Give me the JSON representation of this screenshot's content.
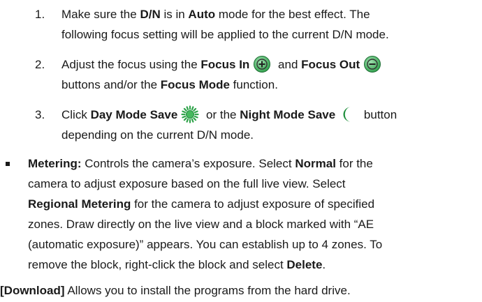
{
  "steps": [
    {
      "num": "1.",
      "l1_a": "Make sure the ",
      "l1_b": "D/N",
      "l1_c": " is in ",
      "l1_d": "Auto",
      "l1_e": " mode for the best effect. The",
      "l2": "following focus setting will be applied to the current D/N mode."
    },
    {
      "num": "2.",
      "l1_a": "Adjust the focus using the ",
      "l1_b": "Focus In",
      "l1_c": " and ",
      "l1_d": "Focus Out",
      "l2_a": "buttons and/or the ",
      "l2_b": "Focus Mode",
      "l2_c": " function."
    },
    {
      "num": "3.",
      "l1_a": "Click ",
      "l1_b": "Day Mode Save",
      "l1_c": " or the ",
      "l1_d": "Night Mode Save",
      "l1_e": " button",
      "l2": "depending on the current D/N mode."
    }
  ],
  "metering": {
    "l1_a": "Metering:",
    "l1_b": " Controls the camera’s exposure. Select ",
    "l1_c": "Normal",
    "l1_d": " for the",
    "l2": "camera to adjust exposure based on the full live view. Select",
    "l3_a": "Regional Metering",
    "l3_b": " for the camera to adjust exposure of specified",
    "l4": "zones. Draw directly on the live view and a block marked with “AE",
    "l5": "(automatic exposure)” appears. You can establish up to 4 zones. To",
    "l6_a": "remove the block, right-click the block and select ",
    "l6_b": "Delete",
    "l6_c": "."
  },
  "download": {
    "a": "[Download]",
    "b": " Allows you to install the programs from the hard drive."
  },
  "icons": {
    "focus_in": "focus-in-plus-icon",
    "focus_out": "focus-out-minus-icon",
    "day_mode": "sun-icon",
    "night_mode": "moon-icon",
    "icon_green": "#2e9e4a",
    "sun_green": "#2fa34a",
    "moon_green": "#1f8f3c"
  }
}
